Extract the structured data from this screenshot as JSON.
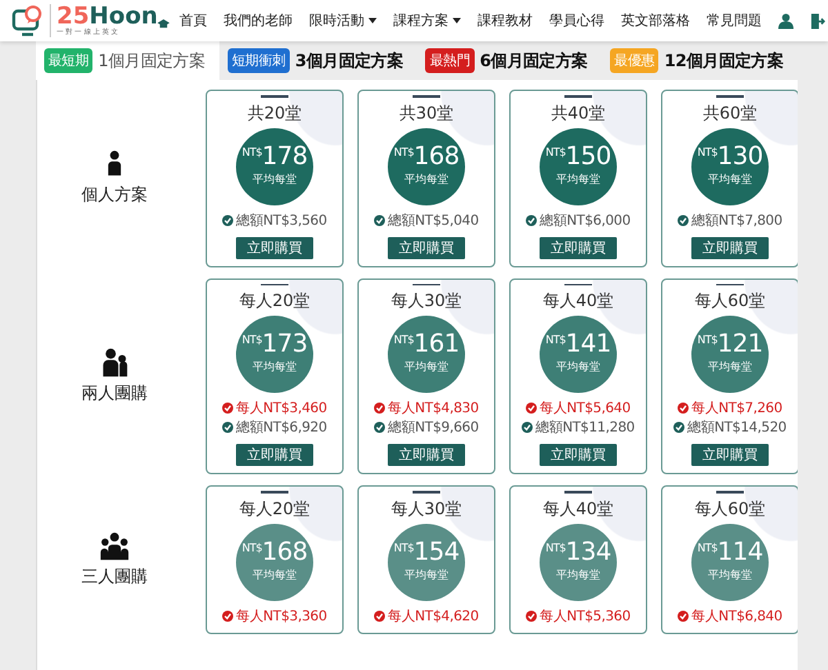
{
  "header": {
    "logo": {
      "number": "25",
      "word": "Hoon",
      "tagline": "一 對 一 線 上 英 文"
    },
    "nav": [
      {
        "label": "首頁",
        "has_menu": false
      },
      {
        "label": "我們的老師",
        "has_menu": false
      },
      {
        "label": "限時活動",
        "has_menu": true
      },
      {
        "label": "課程方案",
        "has_menu": true
      },
      {
        "label": "課程教材",
        "has_menu": false
      },
      {
        "label": "學員心得",
        "has_menu": false
      },
      {
        "label": "英文部落格",
        "has_menu": false
      },
      {
        "label": "常見問題",
        "has_menu": false
      }
    ]
  },
  "tabs": [
    {
      "badge": "最短期",
      "color": "#22b36b",
      "label": "1個月固定方案",
      "selected": true
    },
    {
      "badge": "短期衝刺",
      "color": "#1f6fd0",
      "label": "3個月固定方案",
      "selected": false
    },
    {
      "badge": "最熱門",
      "color": "#d41e1e",
      "label": "6個月固定方案",
      "selected": false
    },
    {
      "badge": "最優惠",
      "color": "#f5a623",
      "label": "12個月固定方案",
      "selected": false
    }
  ],
  "plans": [
    {
      "name": "個人方案",
      "kind": "single",
      "color": "#1e6b60",
      "cards": [
        {
          "title": "共20堂",
          "currency": "NT$",
          "price": "178",
          "unit": "平均每堂",
          "lines": [
            {
              "kind": "total",
              "text": "總額NT$3,560"
            }
          ],
          "button": "立即購買"
        },
        {
          "title": "共30堂",
          "currency": "NT$",
          "price": "168",
          "unit": "平均每堂",
          "lines": [
            {
              "kind": "total",
              "text": "總額NT$5,040"
            }
          ],
          "button": "立即購買"
        },
        {
          "title": "共40堂",
          "currency": "NT$",
          "price": "150",
          "unit": "平均每堂",
          "lines": [
            {
              "kind": "total",
              "text": "總額NT$6,000"
            }
          ],
          "button": "立即購買"
        },
        {
          "title": "共60堂",
          "currency": "NT$",
          "price": "130",
          "unit": "平均每堂",
          "lines": [
            {
              "kind": "total",
              "text": "總額NT$7,800"
            }
          ],
          "button": "立即購買"
        }
      ]
    },
    {
      "name": "兩人團購",
      "kind": "pair",
      "color": "#3e7f76",
      "cards": [
        {
          "title": "每人20堂",
          "currency": "NT$",
          "price": "173",
          "unit": "平均每堂",
          "lines": [
            {
              "kind": "member",
              "text": "每人NT$3,460"
            },
            {
              "kind": "total",
              "text": "總額NT$6,920"
            }
          ],
          "button": "立即購買"
        },
        {
          "title": "每人30堂",
          "currency": "NT$",
          "price": "161",
          "unit": "平均每堂",
          "lines": [
            {
              "kind": "member",
              "text": "每人NT$4,830"
            },
            {
              "kind": "total",
              "text": "總額NT$9,660"
            }
          ],
          "button": "立即購買"
        },
        {
          "title": "每人40堂",
          "currency": "NT$",
          "price": "141",
          "unit": "平均每堂",
          "lines": [
            {
              "kind": "member",
              "text": "每人NT$5,640"
            },
            {
              "kind": "total",
              "text": "總額NT$11,280"
            }
          ],
          "button": "立即購買"
        },
        {
          "title": "每人60堂",
          "currency": "NT$",
          "price": "121",
          "unit": "平均每堂",
          "lines": [
            {
              "kind": "member",
              "text": "每人NT$7,260"
            },
            {
              "kind": "total",
              "text": "總額NT$14,520"
            }
          ],
          "button": "立即購買"
        }
      ]
    },
    {
      "name": "三人團購",
      "kind": "trio",
      "color": "#5a8f88",
      "cards": [
        {
          "title": "每人20堂",
          "currency": "NT$",
          "price": "168",
          "unit": "平均每堂",
          "lines": [
            {
              "kind": "member",
              "text": "每人NT$3,360"
            }
          ]
        },
        {
          "title": "每人30堂",
          "currency": "NT$",
          "price": "154",
          "unit": "平均每堂",
          "lines": [
            {
              "kind": "member",
              "text": "每人NT$4,620"
            }
          ]
        },
        {
          "title": "每人40堂",
          "currency": "NT$",
          "price": "134",
          "unit": "平均每堂",
          "lines": [
            {
              "kind": "member",
              "text": "每人NT$5,360"
            }
          ]
        },
        {
          "title": "每人60堂",
          "currency": "NT$",
          "price": "114",
          "unit": "平均每堂",
          "lines": [
            {
              "kind": "member",
              "text": "每人NT$6,840"
            }
          ]
        }
      ]
    }
  ]
}
